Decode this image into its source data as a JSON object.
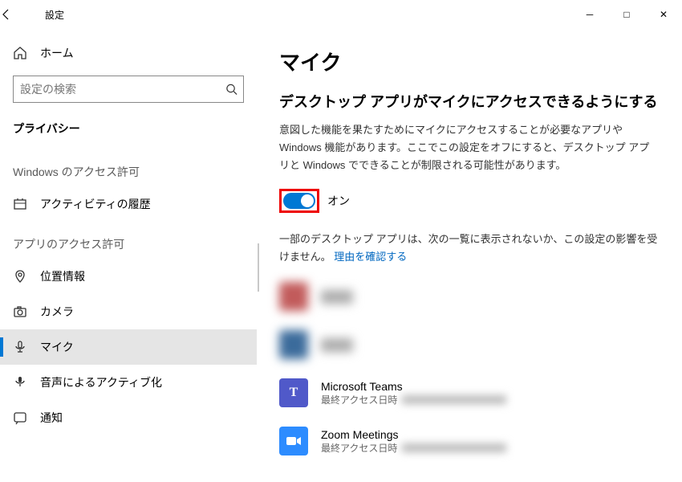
{
  "window": {
    "title": "設定",
    "controls": {
      "minimize": "─",
      "maximize": "□",
      "close": "✕"
    }
  },
  "sidebar": {
    "home_label": "ホーム",
    "search_placeholder": "設定の検索",
    "current_section": "プライバシー",
    "group1_header": "Windows のアクセス許可",
    "group1_items": [
      {
        "id": "activity-history",
        "label": "アクティビティの履歴"
      }
    ],
    "group2_header": "アプリのアクセス許可",
    "group2_items": [
      {
        "id": "location",
        "label": "位置情報"
      },
      {
        "id": "camera",
        "label": "カメラ"
      },
      {
        "id": "microphone",
        "label": "マイク",
        "selected": true
      },
      {
        "id": "voice-activation",
        "label": "音声によるアクティブ化"
      },
      {
        "id": "notifications",
        "label": "通知"
      }
    ]
  },
  "main": {
    "page_title": "マイク",
    "subtitle": "デスクトップ アプリがマイクにアクセスできるようにする",
    "description": "意図した機能を果たすためにマイクにアクセスすることが必要なアプリや Windows 機能があります。ここでこの設定をオフにすると、デスクトップ アプリと Windows でできることが制限される可能性があります。",
    "toggle": {
      "state": "on",
      "label": "オン"
    },
    "note_prefix": "一部のデスクトップ アプリは、次の一覧に表示されないか、この設定の影響を受けません。",
    "note_link": "理由を確認する",
    "apps": [
      {
        "id": "app-1",
        "name": "████",
        "sub": "████",
        "color": "#c25b5b",
        "blur": true
      },
      {
        "id": "app-2",
        "name": "████",
        "sub": "████",
        "color": "#3b6b9b",
        "blur": true
      },
      {
        "id": "teams",
        "name": "Microsoft Teams",
        "sub": "最終アクセス日時",
        "color": "#5059c9",
        "letter": "T",
        "blur": false
      },
      {
        "id": "zoom",
        "name": "Zoom Meetings",
        "sub": "最終アクセス日時",
        "color": "#2d8cff",
        "letter": "▮",
        "blur": false
      }
    ]
  }
}
